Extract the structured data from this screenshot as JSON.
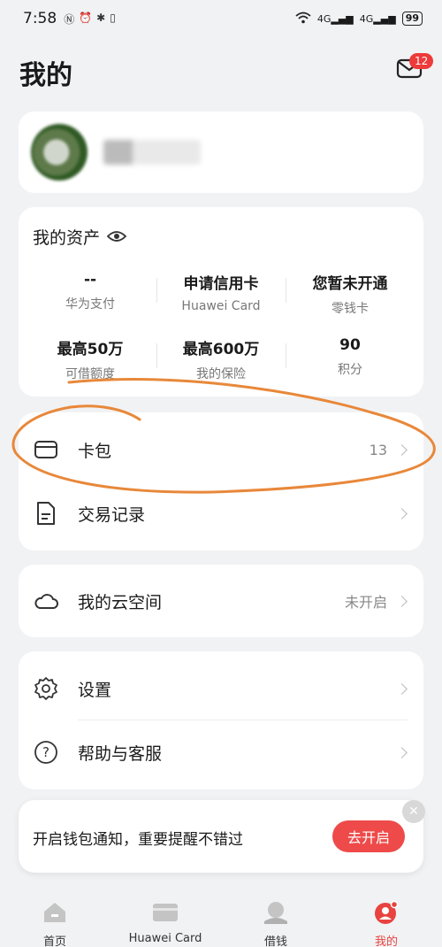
{
  "status_bar": {
    "time": "7:58",
    "network_1": "4G",
    "network_2": "4G",
    "battery": "99"
  },
  "header": {
    "title": "我的",
    "message_badge": "12"
  },
  "assets": {
    "title": "我的资产",
    "items": [
      {
        "value": "--",
        "label": "华为支付"
      },
      {
        "value": "申请信用卡",
        "label": "Huawei Card"
      },
      {
        "value": "您暂未开通",
        "label": "零钱卡"
      },
      {
        "value": "最高50万",
        "label": "可借额度"
      },
      {
        "value": "最高600万",
        "label": "我的保险"
      },
      {
        "value": "90",
        "label": "积分"
      }
    ]
  },
  "card_pkg": {
    "label": "卡包",
    "count": "13"
  },
  "transactions": {
    "label": "交易记录"
  },
  "cloud": {
    "label": "我的云空间",
    "status": "未开启"
  },
  "settings": {
    "label": "设置"
  },
  "help": {
    "label": "帮助与客服"
  },
  "notify": {
    "text": "开启钱包通知，重要提醒不错过",
    "button": "去开启"
  },
  "nav": [
    {
      "label": "首页"
    },
    {
      "label": "Huawei Card"
    },
    {
      "label": "借钱"
    },
    {
      "label": "我的"
    }
  ],
  "colors": {
    "accent": "#e8433f",
    "annotation": "#e8883a"
  }
}
